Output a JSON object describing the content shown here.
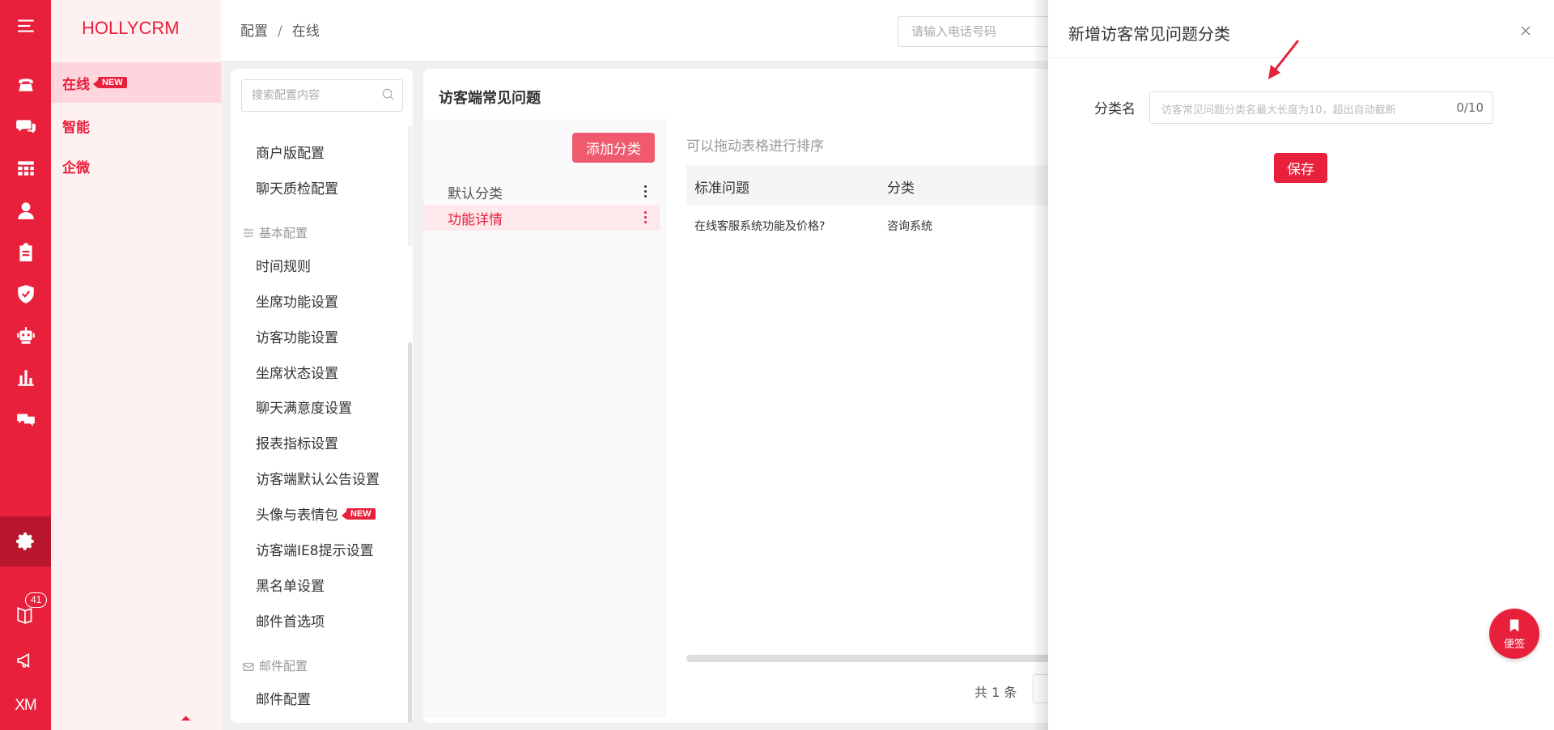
{
  "brand": "HOLLYCRM",
  "rail": {
    "badge_count": "41",
    "xm_label": "XM"
  },
  "nav2": {
    "items": [
      {
        "label": "在线",
        "tag": "NEW"
      },
      {
        "label": "智能"
      },
      {
        "label": "企微"
      }
    ]
  },
  "header": {
    "breadcrumb": [
      "配置",
      "在线"
    ],
    "phone_placeholder": "请输入电话号码"
  },
  "config_list": {
    "search_placeholder": "搜索配置内容",
    "top_items": [
      "商户版配置",
      "聊天质检配置"
    ],
    "section_basic": "基本配置",
    "basic_items": [
      "时间规则",
      "坐席功能设置",
      "访客功能设置",
      "坐席状态设置",
      "聊天满意度设置",
      "报表指标设置",
      "访客端默认公告设置",
      "头像与表情包",
      "访客端IE8提示设置",
      "黑名单设置",
      "邮件首选项"
    ],
    "avatar_tag": "NEW",
    "section_mail": "邮件配置",
    "mail_items": [
      "邮件配置"
    ]
  },
  "faq": {
    "title": "访客端常见问题",
    "add_button": "添加分类",
    "categories": [
      "默认分类",
      "功能详情"
    ],
    "drag_hint": "可以拖动表格进行排序",
    "columns": [
      "标准问题",
      "分类"
    ],
    "rows": [
      {
        "question": "在线客服系统功能及价格?",
        "category": "咨询系统"
      }
    ],
    "total": "共 1 条"
  },
  "drawer": {
    "title": "新增访客常见问题分类",
    "field_label": "分类名",
    "field_placeholder": "访客常见问题分类名最大长度为10，超出自动截断",
    "field_count": "0/10",
    "save_button": "保存"
  },
  "float_button": {
    "label": "便签"
  },
  "colors": {
    "brand_red": "#e8203b",
    "nav_bg": "#fef1f2"
  }
}
